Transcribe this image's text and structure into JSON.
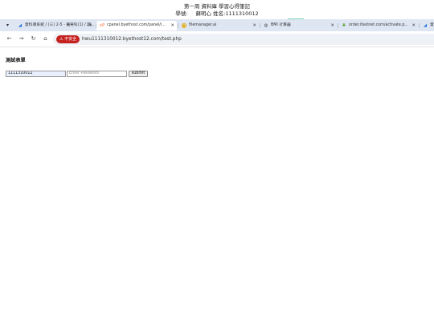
{
  "header": {
    "title": "第一周 資料庫 學習心得筆記",
    "student_id_label": "學號:",
    "student_name": "蘇明心",
    "name_label": "姓名:",
    "name_value": "1111310012"
  },
  "colors": {
    "tabstrip_bg": "#dfe6f3",
    "insecure_badge": "#c5221f",
    "autofill_bg": "#e8f0fe",
    "accent": "#7fd3b5"
  },
  "tabs": [
    {
      "label": "資料庫系統 / (三) 2-5 - 醫男科(1) / 期...",
      "icon": "drive-icon",
      "active": false
    },
    {
      "label": "cpanel.byethost.com/panel/i...",
      "icon": "cpanel-icon",
      "active": true
    },
    {
      "label": "filemanager.ai",
      "icon": "filemanager-icon",
      "active": false
    },
    {
      "label": "BMI 計算器",
      "icon": "globe-icon",
      "active": false
    },
    {
      "label": "order.ifastnet.com/activate.p...",
      "icon": "ifastnet-icon",
      "active": false
    },
    {
      "label": "資",
      "icon": "drive-icon",
      "active": false
    }
  ],
  "toolbar": {
    "insecure_label": "不安全",
    "url": "hwu1111310012.byethost12.com/test.php"
  },
  "page": {
    "heading": "測試表單",
    "username_value": "1111310012",
    "password_placeholder": "Enter Password",
    "submit_label": "submit"
  }
}
